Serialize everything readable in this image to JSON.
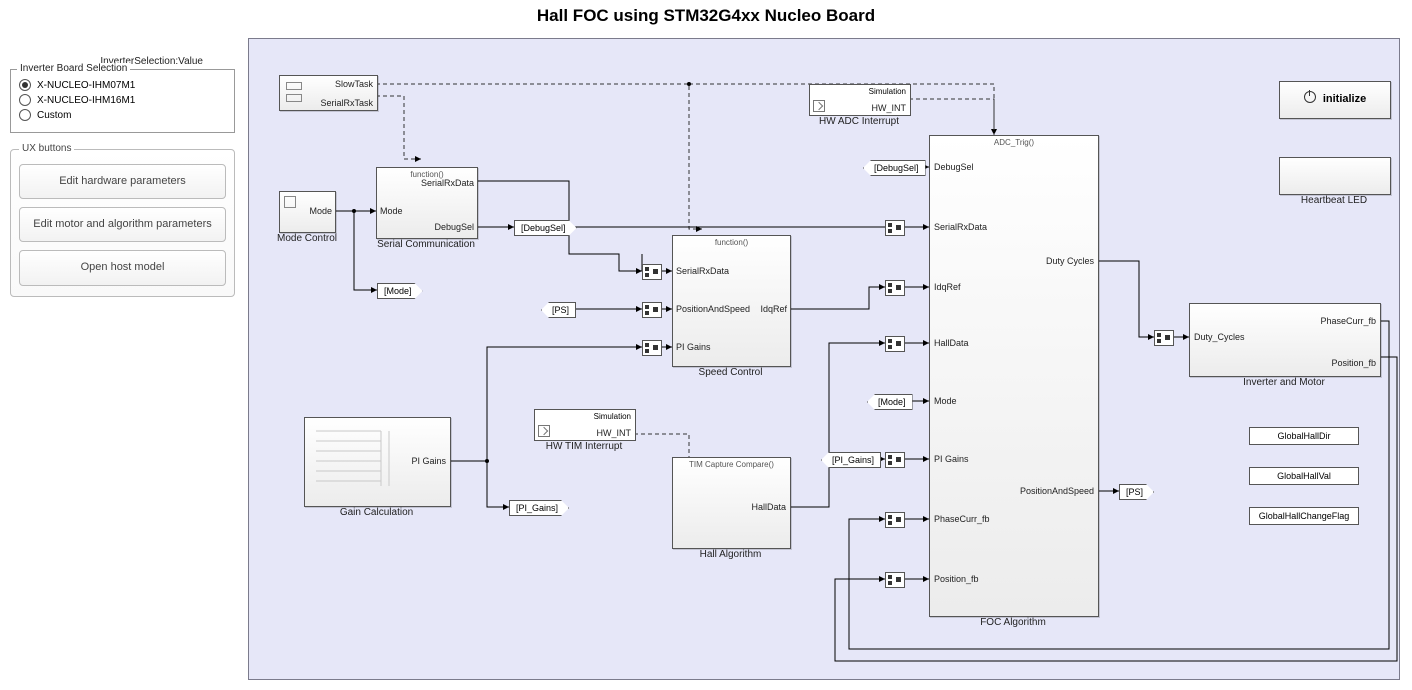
{
  "title": "Hall FOC using STM32G4xx Nucleo Board",
  "left": {
    "param_title": "InverterSelection:Value",
    "group_legend": "Inverter Board Selection",
    "radios": [
      "X-NUCLEO-IHM07M1",
      "X-NUCLEO-IHM16M1",
      "Custom"
    ],
    "selected_index": 0,
    "ux_legend": "UX buttons",
    "ux_buttons": [
      "Edit hardware parameters",
      "Edit motor and algorithm parameters",
      "Open host model"
    ]
  },
  "blocks": {
    "tasks": {
      "slow": "SlowTask",
      "rx": "SerialRxTask"
    },
    "mode_control": {
      "label": "Mode Control",
      "port": "Mode"
    },
    "serial_comm": {
      "label": "Serial Communication",
      "fn": "function()",
      "in": "Mode",
      "out1": "SerialRxData",
      "out2": "DebugSel"
    },
    "speed_control": {
      "label": "Speed Control",
      "fn": "function()",
      "in1": "SerialRxData",
      "in2": "PositionAndSpeed",
      "in3": "PI Gains",
      "out": "IdqRef"
    },
    "gain_calc": {
      "label": "Gain Calculation",
      "out": "PI Gains"
    },
    "hw_tim": {
      "label": "HW TIM Interrupt",
      "type": "Simulation",
      "sig": "HW_INT"
    },
    "hw_adc": {
      "label": "HW ADC Interrupt",
      "type": "Simulation",
      "sig": "HW_INT"
    },
    "hall_alg": {
      "label": "Hall Algorithm",
      "fn": "TIM Capture Compare()",
      "out": "HallData"
    },
    "foc": {
      "label": "FOC Algorithm",
      "fn": "ADC_Trig()",
      "ins": [
        "DebugSel",
        "SerialRxData",
        "IdqRef",
        "HallData",
        "Mode",
        "PI Gains",
        "PhaseCurr_fb",
        "Position_fb"
      ],
      "outs": [
        "Duty Cycles",
        "PositionAndSpeed"
      ]
    },
    "inverter": {
      "label": "Inverter and Motor",
      "in": "Duty_Cycles",
      "out1": "PhaseCurr_fb",
      "out2": "Position_fb"
    },
    "initialize": "initialize",
    "heartbeat": "Heartbeat LED",
    "dstores": [
      "GlobalHallDir",
      "GlobalHallVal",
      "GlobalHallChangeFlag"
    ]
  },
  "tags": {
    "debugsel_goto": "[DebugSel]",
    "debugsel_from": "[DebugSel]",
    "mode_goto": "[Mode]",
    "mode_from": "[Mode]",
    "ps_from": "[PS]",
    "ps_goto": "[PS]",
    "pigains_goto": "[PI_Gains]",
    "pigains_from": "[PI_Gains]"
  }
}
